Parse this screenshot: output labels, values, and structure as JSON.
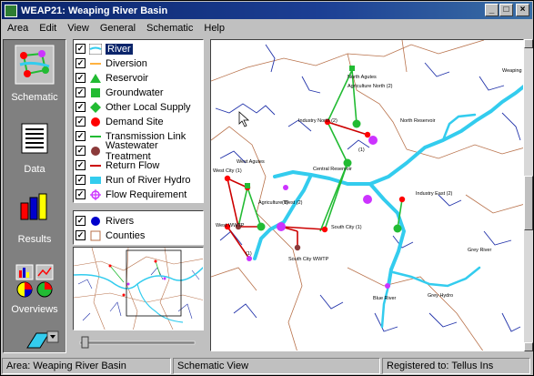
{
  "window": {
    "title": "WEAP21: Weaping River Basin"
  },
  "menu": [
    "Area",
    "Edit",
    "View",
    "General",
    "Schematic",
    "Help"
  ],
  "tools": [
    {
      "label": "Schematic",
      "selected": true
    },
    {
      "label": "Data",
      "selected": false
    },
    {
      "label": "Results",
      "selected": false
    },
    {
      "label": "Overviews",
      "selected": false
    }
  ],
  "legend": [
    {
      "label": "River",
      "symbol": "river",
      "checked": true,
      "selected": true
    },
    {
      "label": "Diversion",
      "symbol": "diversion",
      "checked": true
    },
    {
      "label": "Reservoir",
      "symbol": "reservoir",
      "checked": true
    },
    {
      "label": "Groundwater",
      "symbol": "groundwater",
      "checked": true
    },
    {
      "label": "Other Local Supply",
      "symbol": "local-supply",
      "checked": true
    },
    {
      "label": "Demand Site",
      "symbol": "demand-site",
      "checked": true
    },
    {
      "label": "Transmission Link",
      "symbol": "transmission",
      "checked": true
    },
    {
      "label": "Wastewater Treatment",
      "symbol": "wastewater",
      "checked": true
    },
    {
      "label": "Return Flow",
      "symbol": "return-flow",
      "checked": true
    },
    {
      "label": "Run of River Hydro",
      "symbol": "hydro",
      "checked": true
    },
    {
      "label": "Flow Requirement",
      "symbol": "flow-req",
      "checked": true
    }
  ],
  "layers": [
    {
      "label": "Rivers",
      "symbol": "rivers-layer",
      "checked": true
    },
    {
      "label": "Counties",
      "symbol": "counties-layer",
      "checked": true
    }
  ],
  "map_labels": [
    "North Agutes",
    "Agriculture North (2)",
    "Industry North (2)",
    "North Reservoir",
    "(1)",
    "Weaping River",
    "West Agutes",
    "West City (1)",
    "Central Reservoir",
    "(1)",
    "Agriculture West (2)",
    "Industry East (2)",
    "West WWTP",
    "South City (1)",
    "(1)",
    "South City WWTP",
    "Grey River",
    "Blue River",
    "Grey Hydro"
  ],
  "status": [
    "Area: Weaping River Basin",
    "Schematic View",
    "Registered to: Tellus Ins"
  ],
  "colors": {
    "river": "#33ccee",
    "demand": "#ff0000",
    "transmission": "#22bb33",
    "return": "#cc0000",
    "flowreq": "#cc33ff"
  }
}
